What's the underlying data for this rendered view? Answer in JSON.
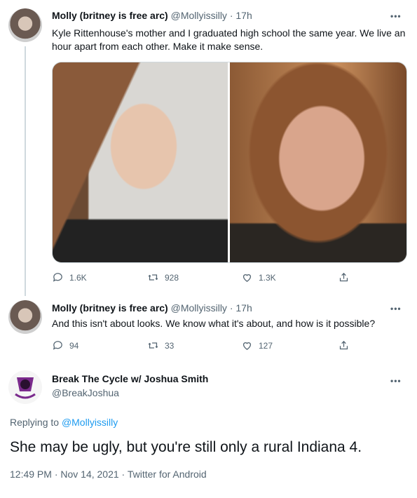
{
  "tweet1": {
    "author": "Molly (britney is free arc)",
    "handle": "@Mollyissilly",
    "dot": "·",
    "time": "17h",
    "text": "Kyle Rittenhouse's mother and I graduated high school the same year. We live an hour apart from each other. Make it make sense.",
    "replies": "1.6K",
    "retweets": "928",
    "likes": "1.3K"
  },
  "tweet2": {
    "author": "Molly (britney is free arc)",
    "handle": "@Mollyissilly",
    "dot": "·",
    "time": "17h",
    "text": "And this isn't about looks. We know what it's about, and how is it possible?",
    "replies": "94",
    "retweets": "33",
    "likes": "127"
  },
  "tweet3": {
    "author": "Break The Cycle w/ Joshua Smith",
    "handle": "@BreakJoshua",
    "replying_prefix": "Replying to",
    "replying_to": "@Mollyissilly",
    "text": "She may be ugly, but you're still only a rural Indiana 4.",
    "timestamp": "12:49 PM · Nov 14, 2021 · Twitter for Android"
  },
  "more_label": "•••",
  "icons": [
    "reply-icon",
    "retweet-icon",
    "like-icon",
    "share-icon"
  ]
}
